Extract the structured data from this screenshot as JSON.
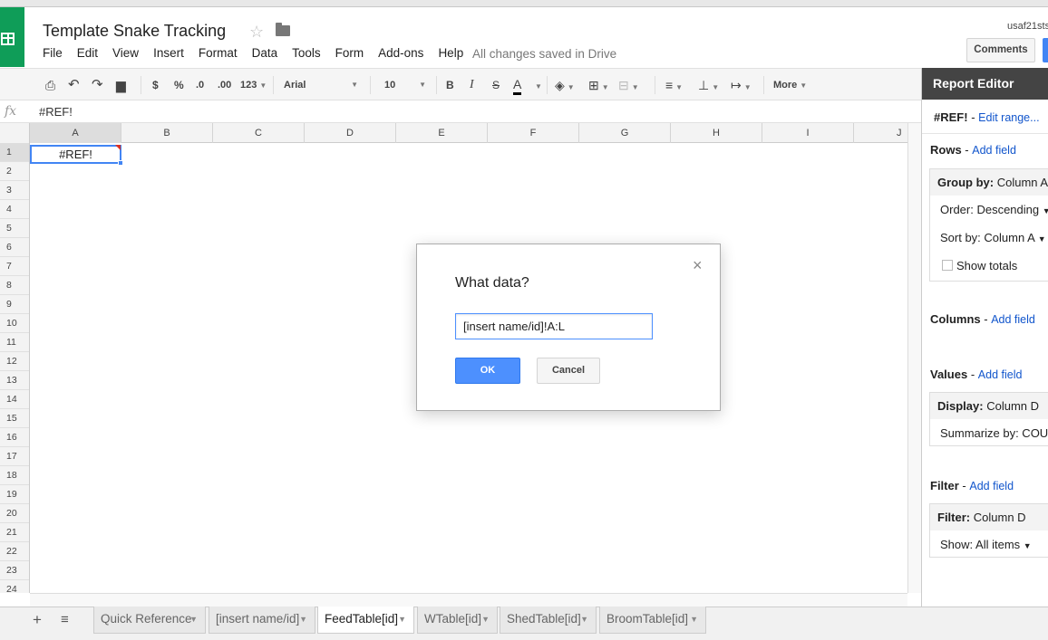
{
  "app": {
    "title": "Template Snake Tracking",
    "save_status": "All changes saved in Drive",
    "user_email": "usaf21sts",
    "comments_label": "Comments",
    "menu": [
      "File",
      "Edit",
      "View",
      "Insert",
      "Format",
      "Data",
      "Tools",
      "Form",
      "Add-ons",
      "Help"
    ]
  },
  "toolbar": {
    "currency": "$",
    "percent": "%",
    "decrease_decimals": ".0",
    "increase_decimals": ".00",
    "more_formats": "123",
    "font": "Arial",
    "font_size": "10",
    "bold": "B",
    "italic": "I",
    "strike": "S",
    "text_color": "A",
    "more": "More"
  },
  "formula_bar": {
    "fx": "fx",
    "value": "#REF!"
  },
  "grid": {
    "columns": [
      "A",
      "B",
      "C",
      "D",
      "E",
      "F",
      "G",
      "H",
      "I",
      "J"
    ],
    "rows": [
      "1",
      "2",
      "3",
      "4",
      "5",
      "6",
      "7",
      "8",
      "9",
      "10",
      "11",
      "12",
      "13",
      "14",
      "15",
      "16",
      "17",
      "18",
      "19",
      "20",
      "21",
      "22",
      "23",
      "24"
    ],
    "active_cell_value": "#REF!"
  },
  "dialog": {
    "title": "What data?",
    "input_value": "[insert name/id]!A:L",
    "ok_label": "OK",
    "cancel_label": "Cancel",
    "close_glyph": "×"
  },
  "report_editor": {
    "title": "Report Editor",
    "range": "#REF!",
    "range_sep": "-",
    "edit_range": "Edit range...",
    "rows_label": "Rows",
    "columns_label": "Columns",
    "values_label": "Values",
    "filter_label": "Filter",
    "section_sep": "-",
    "add_field": "Add field",
    "group_by_label": "Group by:",
    "group_by_value": "Column A",
    "order": "Order: Descending",
    "sort_by": "Sort by: Column A",
    "show_totals": "Show totals",
    "display_label": "Display:",
    "display_value": "Column D",
    "summarize": "Summarize by: COU",
    "filter_box_label": "Filter:",
    "filter_box_value": "Column D",
    "show_items": "Show: All items"
  },
  "sheets": {
    "add_glyph": "+",
    "list_glyph": "≡",
    "tabs": [
      "Quick Reference",
      "[insert name/id]",
      "FeedTable[id]",
      "WTable[id]",
      "ShedTable[id]",
      "BroomTable[id]"
    ],
    "active_tab": "FeedTable[id]"
  },
  "colors": {
    "accent_blue": "#4285f4",
    "sheets_green": "#0f9d58",
    "link_blue": "#1155cc"
  }
}
